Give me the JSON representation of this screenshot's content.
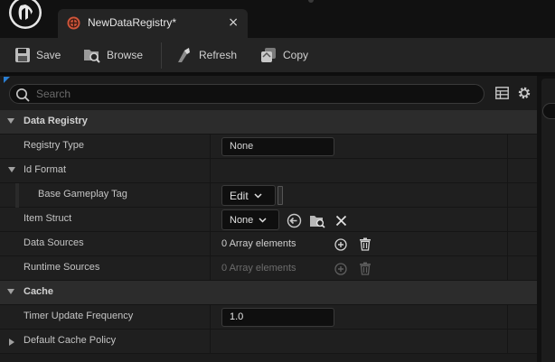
{
  "tab": {
    "title": "NewDataRegistry*",
    "close_glyph": "×"
  },
  "toolbar": {
    "save_label": "Save",
    "browse_label": "Browse",
    "refresh_label": "Refresh",
    "copy_label": "Copy"
  },
  "search": {
    "placeholder": "Search"
  },
  "rows": {
    "data_registry": {
      "label": "Data Registry"
    },
    "registry_type": {
      "label": "Registry Type",
      "value": "None"
    },
    "id_format": {
      "label": "Id Format"
    },
    "base_gameplay_tag": {
      "label": "Base Gameplay Tag",
      "value": "Edit"
    },
    "item_struct": {
      "label": "Item Struct",
      "value": "None"
    },
    "data_sources": {
      "label": "Data Sources",
      "value": "0 Array elements"
    },
    "runtime_sources": {
      "label": "Runtime Sources",
      "value": "0 Array elements"
    },
    "cache": {
      "label": "Cache"
    },
    "timer_update_frequency": {
      "label": "Timer Update Frequency",
      "value": "1.0"
    },
    "default_cache_policy": {
      "label": "Default Cache Policy"
    }
  },
  "colors": {
    "accent": "#2a7fd4",
    "tab_icon": "#d0553a"
  },
  "icons": [
    "unreal-logo-icon",
    "data-registry-icon",
    "save-icon",
    "browse-icon",
    "refresh-icon",
    "copy-icon",
    "search-icon",
    "grid-icon",
    "gear-icon",
    "chevron-down-icon",
    "use-selected-icon",
    "browse-asset-icon",
    "clear-icon",
    "add-icon",
    "delete-icon"
  ]
}
